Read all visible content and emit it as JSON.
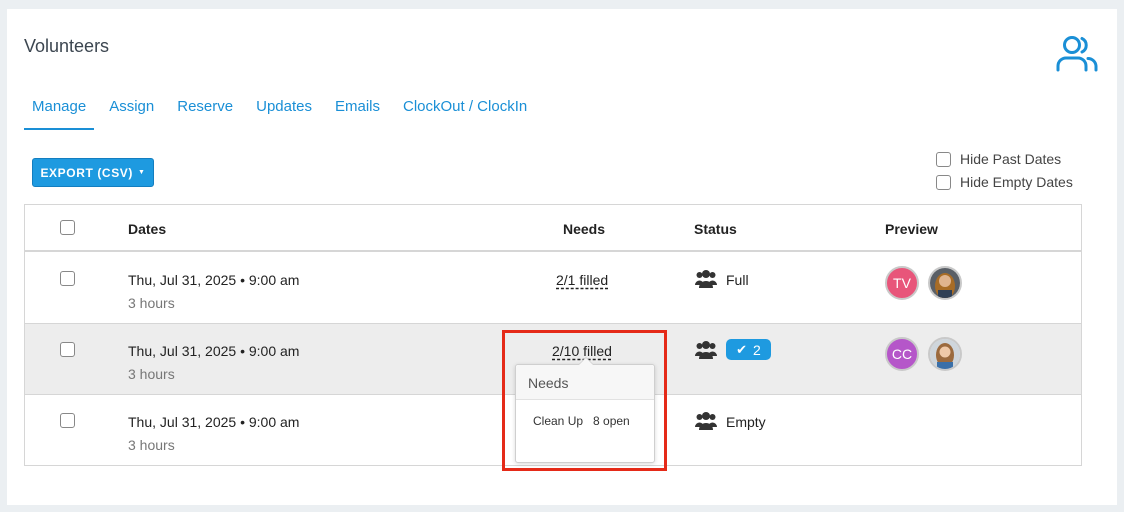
{
  "page": {
    "title": "Volunteers"
  },
  "tabs": [
    {
      "label": "Manage",
      "active": true
    },
    {
      "label": "Assign",
      "active": false
    },
    {
      "label": "Reserve",
      "active": false
    },
    {
      "label": "Updates",
      "active": false
    },
    {
      "label": "Emails",
      "active": false
    },
    {
      "label": "ClockOut / ClockIn",
      "active": false
    }
  ],
  "toolbar": {
    "export_label": "EXPORT (CSV)"
  },
  "filters": {
    "hide_past": "Hide Past Dates",
    "hide_empty": "Hide Empty Dates"
  },
  "table": {
    "headers": {
      "dates": "Dates",
      "needs": "Needs",
      "status": "Status",
      "preview": "Preview"
    },
    "rows": [
      {
        "date": "Thu, Jul 31, 2025 • 9:00 am",
        "duration": "3 hours",
        "needs": "2/1 filled",
        "status": "Full",
        "avatar_initials": "TV"
      },
      {
        "date": "Thu, Jul 31, 2025 • 9:00 am",
        "duration": "3 hours",
        "needs": "2/10 filled",
        "badge_count": "2",
        "avatar_initials": "CC"
      },
      {
        "date": "Thu, Jul 31, 2025 • 9:00 am",
        "duration": "3 hours",
        "needs": "",
        "status": "Empty"
      }
    ]
  },
  "popover": {
    "title": "Needs",
    "item_name": "Clean Up",
    "item_open": "8 open"
  },
  "colors": {
    "accent": "#1e9ae0",
    "link": "#1a8fd6",
    "highlight_box": "#e52a18",
    "avatar_tv": "#e8557a",
    "avatar_cc": "#b556c9"
  },
  "icons": [
    "people-outline-icon",
    "group-icon",
    "check-icon",
    "caret-down-icon"
  ]
}
